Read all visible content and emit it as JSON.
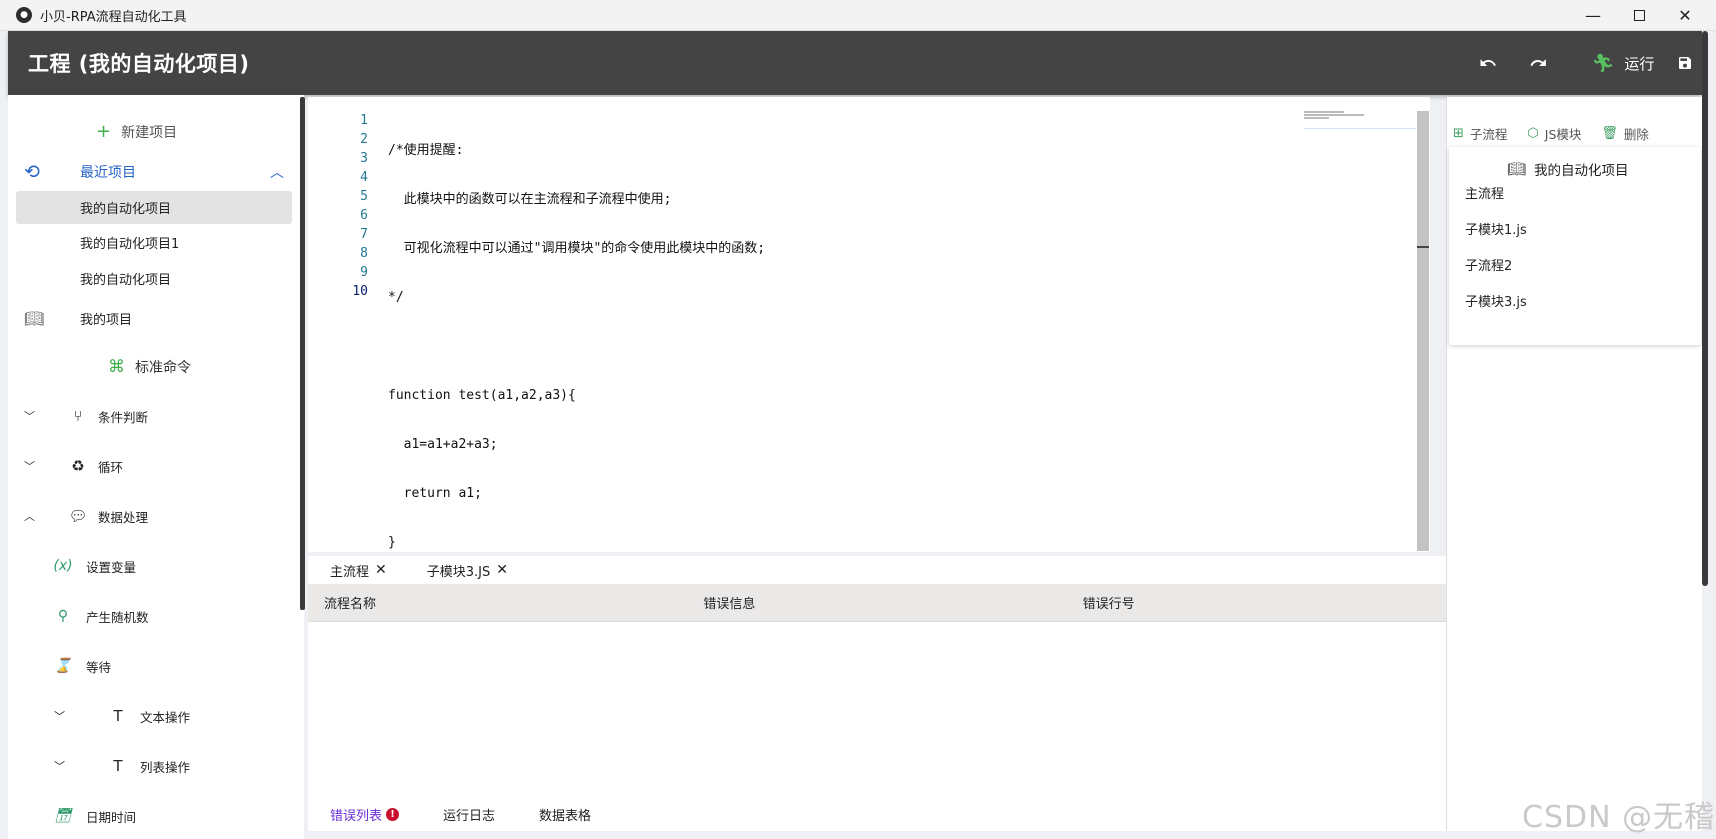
{
  "window": {
    "title": "小贝-RPA流程自动化工具",
    "min": "—",
    "close": "✕"
  },
  "header": {
    "title": "工程 (我的自动化项目)",
    "undo_icon": "undo-icon",
    "redo_icon": "redo-icon",
    "run_label": "运行",
    "save_icon": "save-icon"
  },
  "sidebar": {
    "new_project": "新建项目",
    "recent_label": "最近项目",
    "recent_items": [
      "我的自动化项目",
      "我的自动化项目1",
      "我的自动化项目"
    ],
    "my_projects": "我的项目",
    "standard_commands": "标准命令",
    "commands": [
      "条件判断",
      "循环",
      "数据处理"
    ],
    "sub_commands": [
      "设置变量",
      "产生随机数",
      "等待"
    ],
    "sub2": [
      "文本操作",
      "列表操作"
    ],
    "datetime": "日期时间",
    "sub_icons": [
      "(x)",
      "⚲",
      "⌛"
    ]
  },
  "editor": {
    "line_numbers": [
      "1",
      "2",
      "3",
      "4",
      "5",
      "6",
      "7",
      "8",
      "9",
      "10"
    ],
    "lines": [
      "/*使用提醒:",
      "  此模块中的函数可以在主流程和子流程中使用;",
      "  可视化流程中可以通过\"调用模块\"的命令使用此模块中的函数;",
      "*/",
      "",
      "function test(a1,a2,a3){",
      "  a1=a1+a2+a3;",
      "  return a1;",
      "}",
      ""
    ]
  },
  "tabs": [
    {
      "label": "主流程",
      "close": "✕"
    },
    {
      "label": "子模块3.JS",
      "close": "✕"
    }
  ],
  "errors": {
    "columns": [
      "流程名称",
      "错误信息",
      "错误行号"
    ]
  },
  "bottom_tabs": [
    {
      "label": "错误列表",
      "badge": "!"
    },
    {
      "label": "运行日志"
    },
    {
      "label": "数据表格"
    }
  ],
  "right_panel": {
    "tools": [
      "子流程",
      "JS模块",
      "删除"
    ],
    "project_title": "我的自动化项目",
    "items": [
      "主流程",
      "子模块1.js",
      "子流程2",
      "子模块3.js"
    ]
  },
  "watermark": "CSDN @无稽"
}
